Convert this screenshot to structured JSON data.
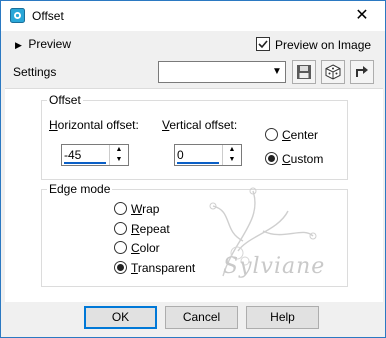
{
  "window": {
    "title": "Offset",
    "close_symbol": "✕"
  },
  "preview": {
    "label": "Preview",
    "preview_on_image_label": "Preview on Image",
    "preview_on_image_checked": true
  },
  "settings": {
    "label": "Settings",
    "value": ""
  },
  "offset": {
    "title": "Offset",
    "horizontal_label_u": "H",
    "horizontal_label_rest": "orizontal offset:",
    "horizontal_value": "-45",
    "vertical_label_u": "V",
    "vertical_label_rest": "ertical offset:",
    "vertical_value": "0",
    "center_label_u": "C",
    "center_label_rest": "enter",
    "custom_label_u": "C",
    "custom_label_rest": "ustom",
    "selected": "custom"
  },
  "edge_mode": {
    "title": "Edge mode",
    "options": [
      {
        "u": "W",
        "rest": "rap",
        "checked": false
      },
      {
        "u": "R",
        "rest": "epeat",
        "checked": false
      },
      {
        "u": "C",
        "rest": "olor",
        "checked": false
      },
      {
        "u": "T",
        "rest": "ransparent",
        "checked": true
      }
    ]
  },
  "watermark_text": "Sylviane",
  "buttons": {
    "ok": "OK",
    "cancel": "Cancel",
    "help": "Help"
  },
  "colors": {
    "accent": "#0078d7",
    "border_blue": "#2b79c2"
  }
}
